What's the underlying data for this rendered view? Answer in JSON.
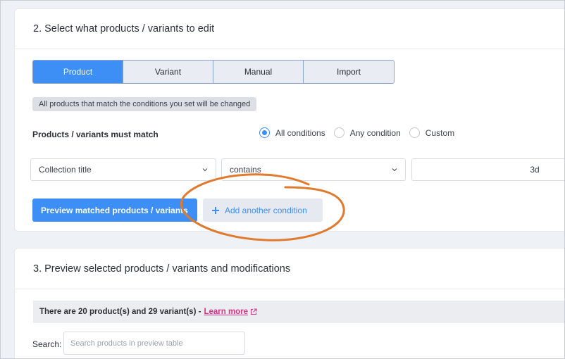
{
  "section2": {
    "title": "2. Select what products / variants to edit",
    "tabs": [
      {
        "label": "Product",
        "active": true
      },
      {
        "label": "Variant",
        "active": false
      },
      {
        "label": "Manual",
        "active": false
      },
      {
        "label": "Import",
        "active": false
      }
    ],
    "hint": "All products that match the conditions you set will be changed",
    "match_label": "Products / variants must match",
    "match_options": [
      {
        "label": "All conditions",
        "checked": true
      },
      {
        "label": "Any condition",
        "checked": false
      },
      {
        "label": "Custom",
        "checked": false
      }
    ],
    "condition": {
      "field": "Collection title",
      "operator": "contains",
      "value": "3d"
    },
    "preview_button": "Preview matched products / variants",
    "add_condition_button": "Add another condition"
  },
  "section3": {
    "title": "3. Preview selected products / variants and modifications",
    "info_text": "There are 20 product(s) and 29 variant(s) -",
    "learn_more": "Learn more",
    "search_label": "Search:",
    "search_placeholder": "Search products in preview table"
  },
  "colors": {
    "accent": "#3d8ff5",
    "annotation": "#e07a2e",
    "link": "#d63384"
  }
}
